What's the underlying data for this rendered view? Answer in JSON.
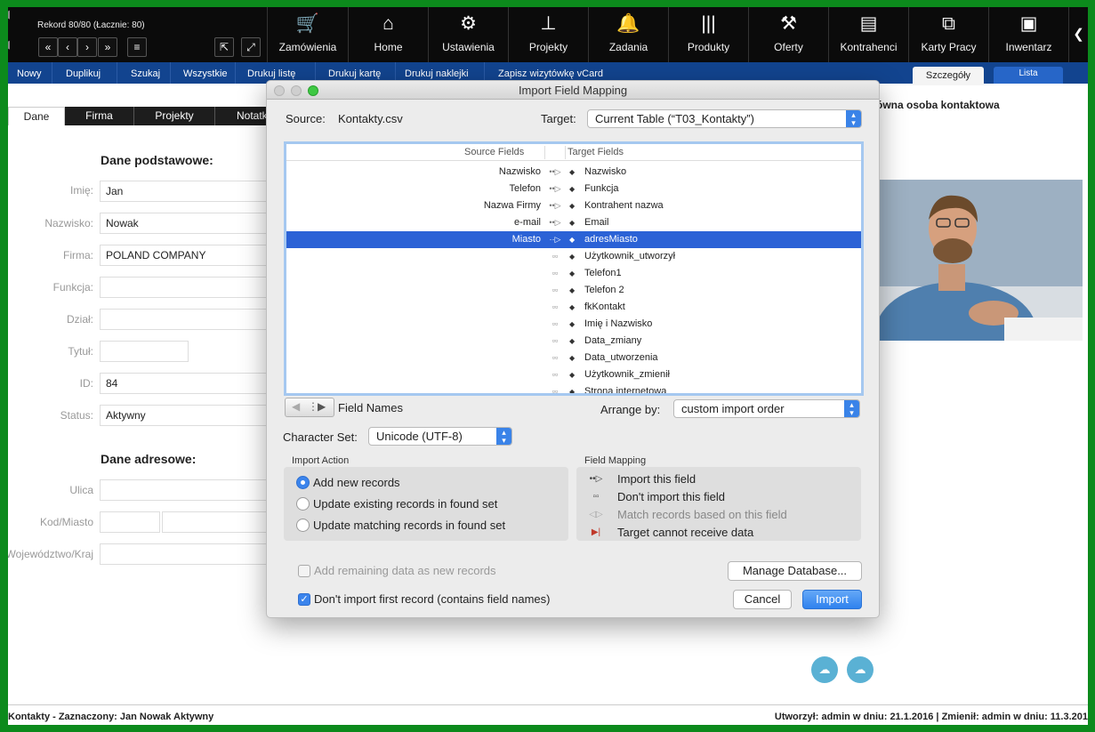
{
  "app": {
    "record_label": "Rekord 80/80 (Łacznie: 80)",
    "record_buttons": [
      "«",
      "‹",
      "›",
      "»",
      "≡"
    ],
    "toolbar": [
      {
        "label": "Zamówienia",
        "icon": "cart-icon",
        "glyph": "🛒"
      },
      {
        "label": "Home",
        "icon": "home-icon",
        "glyph": "⌂"
      },
      {
        "label": "Ustawienia",
        "icon": "gear-icon",
        "glyph": "⚙"
      },
      {
        "label": "Projekty",
        "icon": "sitemap-icon",
        "glyph": "⊥"
      },
      {
        "label": "Zadania",
        "icon": "bell-icon",
        "glyph": "🔔"
      },
      {
        "label": "Produkty",
        "icon": "barcode-icon",
        "glyph": "|||"
      },
      {
        "label": "Oferty",
        "icon": "gavel-icon",
        "glyph": "⚒"
      },
      {
        "label": "Kontrahenci",
        "icon": "briefcase-icon",
        "glyph": "▤"
      },
      {
        "label": "Karty Pracy",
        "icon": "copy-icon",
        "glyph": "⧉"
      },
      {
        "label": "Inwentarz",
        "icon": "archive-icon",
        "glyph": "▣"
      }
    ],
    "actions": [
      "Nowy",
      "Duplikuj",
      "Szukaj",
      "Wszystkie",
      "Drukuj listę",
      "Drukuj kartę",
      "Drukuj naklejki",
      "Zapisz wizytówkę vCard"
    ],
    "view_tabs": {
      "details": "Szczegóły",
      "list": "Lista"
    }
  },
  "form": {
    "tabs": [
      "Dane",
      "Firma",
      "Projekty",
      "Notatki"
    ],
    "section_basic": "Dane podstawowe:",
    "section_address": "Dane adresowe:",
    "fields": [
      {
        "label": "Imię:",
        "value": "Jan"
      },
      {
        "label": "Nazwisko:",
        "value": "Nowak"
      },
      {
        "label": "Firma:",
        "value": "POLAND COMPANY"
      },
      {
        "label": "Funkcja:",
        "value": ""
      },
      {
        "label": "Dział:",
        "value": ""
      },
      {
        "label": "Tytuł:",
        "value": ""
      },
      {
        "label": "ID:",
        "value": "84"
      },
      {
        "label": "Status:",
        "value": "Aktywny"
      }
    ],
    "address_fields": [
      {
        "label": "Ulica"
      },
      {
        "label": "Kod/Miasto"
      },
      {
        "label": "Województwo/Kraj"
      }
    ],
    "contact_heading": "ówna osoba kontaktowa"
  },
  "status_bar": {
    "left": "Kontakty - Zaznaczony: Jan Nowak Aktywny",
    "right": "Utworzył: admin w dniu: 21.1.2016 | Zmienił: admin w dniu: 11.3.201"
  },
  "dialog": {
    "title": "Import Field Mapping",
    "source_label": "Source:",
    "source_value": "Kontakty.csv",
    "target_label": "Target:",
    "target_value": "Current Table (“T03_Kontakty”)",
    "header_source": "Source Fields",
    "header_target": "Target Fields",
    "mappings": [
      {
        "source": "Nazwisko",
        "arrow": "••▷",
        "target": "Nazwisko"
      },
      {
        "source": "Telefon",
        "arrow": "••▷",
        "target": "Funkcja"
      },
      {
        "source": "Nazwa Firmy",
        "arrow": "••▷",
        "target": "Kontrahent nazwa"
      },
      {
        "source": "e-mail",
        "arrow": "••▷",
        "target": "Email"
      },
      {
        "source": "Miasto",
        "arrow": "··▷",
        "target": "adresMiasto",
        "selected": true
      },
      {
        "source": "",
        "arrow": "▫▫",
        "target": "Użytkownik_utworzył"
      },
      {
        "source": "",
        "arrow": "▫▫",
        "target": "Telefon1"
      },
      {
        "source": "",
        "arrow": "▫▫",
        "target": "Telefon 2"
      },
      {
        "source": "",
        "arrow": "▫▫",
        "target": "fkKontakt"
      },
      {
        "source": "",
        "arrow": "▫▫",
        "target": "Imię i Nazwisko"
      },
      {
        "source": "",
        "arrow": "▫▫",
        "target": "Data_zmiany"
      },
      {
        "source": "",
        "arrow": "▫▫",
        "target": "Data_utworzenia"
      },
      {
        "source": "",
        "arrow": "▫▫",
        "target": "Użytkownik_zmienił"
      },
      {
        "source": "",
        "arrow": "▫▫",
        "target": "Strona internetowa"
      }
    ],
    "field_names_label": "Field Names",
    "arrange_label": "Arrange by:",
    "arrange_value": "custom import order",
    "charset_label": "Character Set:",
    "charset_value": "Unicode (UTF-8)",
    "import_action_title": "Import Action",
    "import_actions": [
      {
        "label": "Add new records",
        "selected": true
      },
      {
        "label": "Update existing records in found set",
        "selected": false
      },
      {
        "label": "Update matching records in found set",
        "selected": false
      }
    ],
    "field_mapping_title": "Field Mapping",
    "legend": [
      {
        "icon": "••▷",
        "label": "Import this field"
      },
      {
        "icon": "▫▫",
        "label": "Don't import this field"
      },
      {
        "icon": "◁▷",
        "label": "Match records based on this field"
      },
      {
        "icon": "▶|",
        "label": "Target cannot receive data"
      }
    ],
    "add_remaining_label": "Add remaining data as new records",
    "dont_import_first_label": "Don't import first record (contains field names)",
    "manage_db_button": "Manage Database...",
    "cancel_button": "Cancel",
    "import_button": "Import"
  }
}
